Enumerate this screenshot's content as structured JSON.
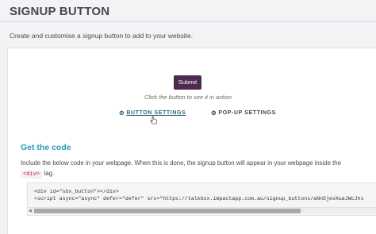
{
  "header": {
    "title": "SIGNUP BUTTON",
    "description": "Create and customise a signup button to add to your website."
  },
  "preview": {
    "submit_label": "Submit",
    "hint": "Click the button to see it in action"
  },
  "tabs": [
    {
      "label": "BUTTON SETTINGS",
      "icon": "gear-icon",
      "active": true
    },
    {
      "label": "POP-UP SETTINGS",
      "icon": "gear-icon",
      "active": false
    }
  ],
  "code_section": {
    "title": "Get the code",
    "instruction_before": "Include the below code in your webpage. When this is done, the signup button will appear in your webpage inside the",
    "instruction_tag": "<div>",
    "instruction_after": "tag.",
    "code_lines": [
      "<div id=\"sbx_button\"></div>",
      "<script async=\"async\" defer=\"defer\" src=\"https://talkbox.impactapp.com.au/signup_buttons/aNn5jevXuaJWcJhs"
    ]
  },
  "colors": {
    "accent": "#2a9cb8",
    "button_bg": "#4f2a4f",
    "active_tab": "#2e6478",
    "code_tag": "#c7254e"
  }
}
